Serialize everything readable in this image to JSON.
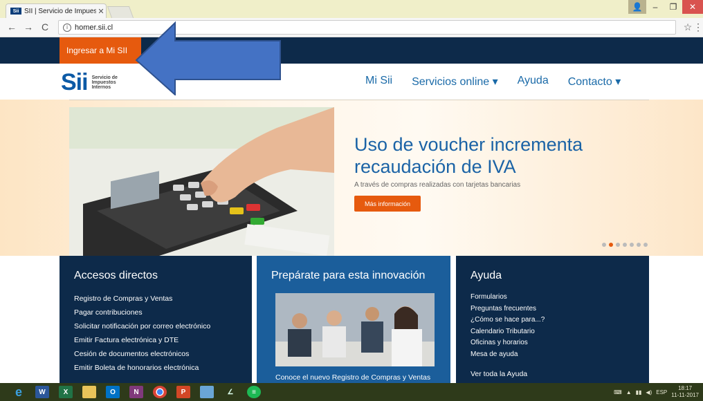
{
  "browser": {
    "tab_title": "SII | Servicio de Impuesto",
    "tab_favicon": "Sii",
    "url": "homer.sii.cl",
    "back": "←",
    "forward": "→",
    "reload": "C",
    "star": "☆"
  },
  "site": {
    "ingresar_label": "Ingresar a Mi SII",
    "logo_text": "Sii",
    "logo_words": [
      "Servicio de",
      "Impuestos",
      "Internos"
    ],
    "nav": [
      "Mi Sii",
      "Servicios online ▾",
      "Ayuda",
      "Contacto ▾"
    ],
    "hero": {
      "headline": "Uso de voucher incrementa recaudación de IVA",
      "subline": "A través de compras realizadas con tarjetas bancarias",
      "button": "Más información",
      "slides_total": 7,
      "slide_active": 2
    },
    "accesos": {
      "title": "Accesos directos",
      "items": [
        "Registro de Compras y Ventas",
        "Pagar contribuciones",
        "Solicitar notificación por correo electrónico",
        "Emitir Factura electrónica y DTE",
        "Cesión de documentos electrónicos",
        "Emitir Boleta de honorarios electrónica"
      ]
    },
    "preparate": {
      "title": "Prepárate para esta innovación",
      "caption": "Conoce el nuevo Registro de Compras y Ventas"
    },
    "ayuda": {
      "title": "Ayuda",
      "items": [
        "Formularios",
        "Preguntas frecuentes",
        "¿Cómo se hace para...?",
        "Calendario Tributario",
        "Oficinas y horarios",
        "Mesa de ayuda"
      ],
      "more": "Ver toda la Ayuda"
    }
  },
  "taskbar": {
    "lang": "ESP",
    "time": "18:17",
    "date": "11-11-2017"
  },
  "colors": {
    "brand_orange": "#e65a0e",
    "dark_navy": "#0d2a4a",
    "sii_blue": "#1b63a6",
    "arrow_blue": "#4472c4"
  }
}
